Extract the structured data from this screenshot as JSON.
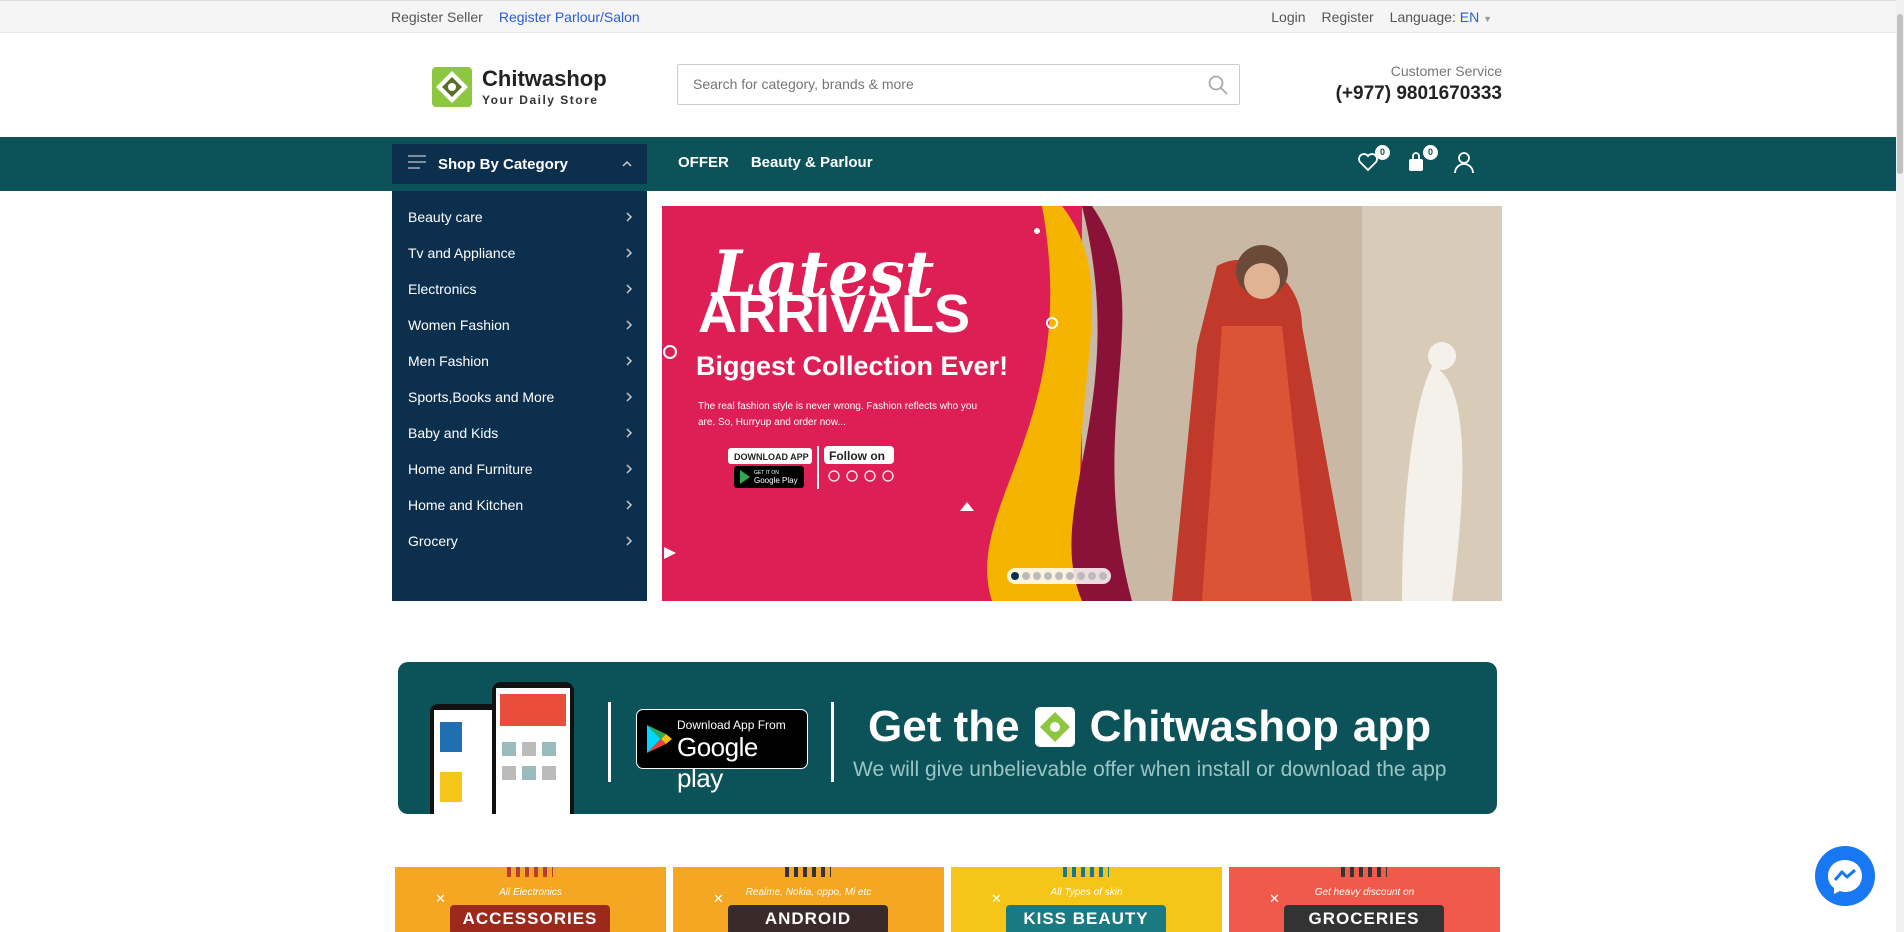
{
  "topbar": {
    "register_seller": "Register Seller",
    "register_parlour": "Register Parlour/Salon",
    "login": "Login",
    "register": "Register",
    "language_label": "Language:",
    "language_value": "EN"
  },
  "header": {
    "logo_name": "Chitwashop",
    "logo_tagline": "Your Daily Store",
    "search_placeholder": "Search for category, brands & more",
    "customer_service_label": "Customer Service",
    "customer_service_phone": "(+977) 9801670333"
  },
  "nav": {
    "category_button": "Shop By Category",
    "links": [
      "OFFER",
      "Beauty & Parlour"
    ],
    "wishlist_count": "0",
    "cart_count": "0"
  },
  "categories": [
    "Beauty care",
    "Tv and Appliance",
    "Electronics",
    "Women Fashion",
    "Men Fashion",
    "Sports,Books and More",
    "Baby and Kids",
    "Home and Furniture",
    "Home and Kitchen",
    "Grocery"
  ],
  "hero": {
    "line1": "Latest",
    "line2": "ARRIVALS",
    "headline": "Biggest Collection Ever!",
    "body_1": "The real fashion style is never wrong. Fashion reflects who you",
    "body_2": "are. So, Hurryup and order now...",
    "download_label": "DOWNLOAD APP",
    "gp_small": "GET IT ON",
    "gp_big": "Google Play",
    "follow_label": "Follow on",
    "slide_count": 9,
    "active_slide": 1
  },
  "app_banner": {
    "gp_small": "Download App From",
    "gp_big": "Google play",
    "get_the": "Get the",
    "brand": "Chitwashop",
    "app": "app",
    "subtitle": "We will give unbelievable offer when install or download the app"
  },
  "tiles": [
    {
      "script": "All Electronics",
      "label": "ACCESSORIES",
      "bg": "#f5a623",
      "ribbon": "#9b2a1d"
    },
    {
      "script": "Realme, Nokia, oppo, Mi etc",
      "label": "ANDROID",
      "bg": "#f5a623",
      "ribbon": "#3a2a2a"
    },
    {
      "script": "All Types of skin",
      "label": "KISS BEAUTY",
      "bg": "#f5c518",
      "ribbon": "#1a7a82"
    },
    {
      "script": "Get heavy discount on",
      "label": "GROCERIES",
      "bg": "#f15a4a",
      "ribbon": "#333"
    }
  ],
  "colors": {
    "nav_bg": "#0b5358",
    "menu_bg": "#0c2f4e",
    "hero_bg": "#dd1f55",
    "link": "#2a5bd7"
  }
}
